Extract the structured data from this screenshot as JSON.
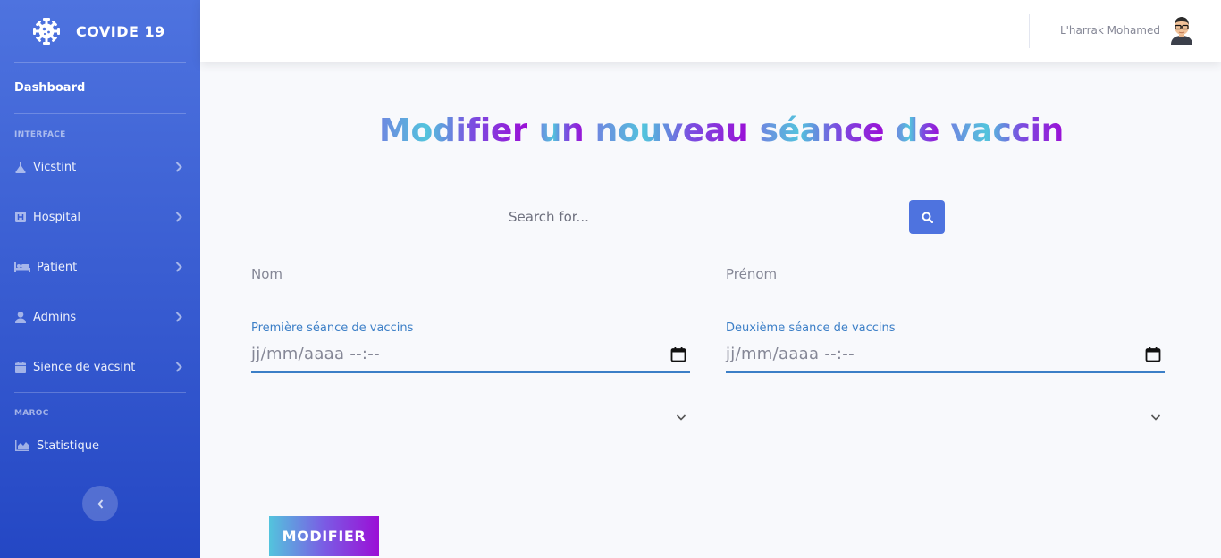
{
  "sidebar": {
    "brand": "COVIDE 19",
    "dashboard": "Dashboard",
    "heading_interface": "INTERFACE",
    "items": [
      {
        "label": "Vicstint",
        "icon": "flask-icon"
      },
      {
        "label": "Hospital",
        "icon": "hospital-icon"
      },
      {
        "label": "Patient",
        "icon": "bed-icon"
      },
      {
        "label": "Admins",
        "icon": "user-icon"
      },
      {
        "label": "Sience de vacsint",
        "icon": "calendar-icon"
      }
    ],
    "heading_maroc": "MAROC",
    "statistique": "Statistique"
  },
  "topbar": {
    "user_name": "L'harrak Mohamed"
  },
  "main": {
    "title_words": [
      "Modifier",
      "un",
      "nouveau",
      "séance",
      "de",
      "vaccin"
    ],
    "search_placeholder": "Search for...",
    "nom_placeholder": "Nom",
    "prenom_placeholder": "Prénom",
    "premiere_label": "Première séance de vaccins",
    "deuxieme_label": "Deuxième séance de vaccins",
    "date_placeholder": "jj/mm/aaaa --:--",
    "submit_label": "MODIFIER"
  },
  "colors": {
    "sidebar_top": "#4e73df",
    "sidebar_bottom": "#2447c4",
    "accent": "#4e73df",
    "date_underline": "#3c7fc7"
  }
}
